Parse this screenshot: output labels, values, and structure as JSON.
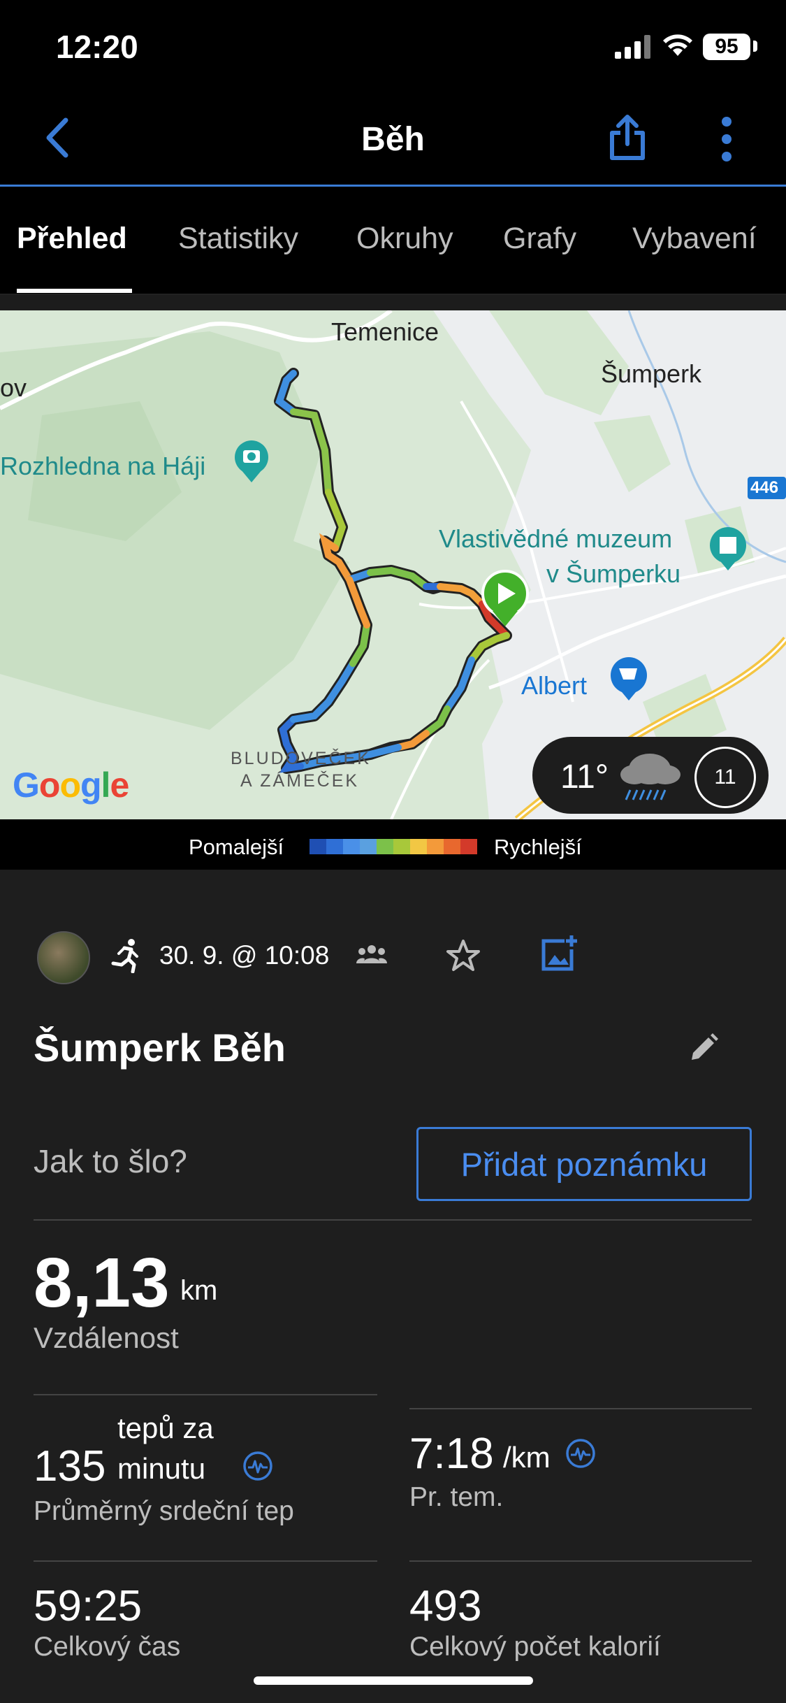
{
  "status_bar": {
    "time": "12:20",
    "battery": "95"
  },
  "nav": {
    "title": "Běh",
    "icons": [
      "back-chevron-icon",
      "share-icon",
      "more-vertical-icon"
    ]
  },
  "tabs": [
    {
      "label": "Přehled",
      "active": true
    },
    {
      "label": "Statistiky",
      "active": false
    },
    {
      "label": "Okruhy",
      "active": false
    },
    {
      "label": "Grafy",
      "active": false
    },
    {
      "label": "Vybavení",
      "active": false
    }
  ],
  "map": {
    "labels": {
      "temenice": "Temenice",
      "sumperk": "Šumperk",
      "rozhledna": "Rozhledna na Háji",
      "muzeum_line1": "Vlastivědné muzeum",
      "muzeum_line2": "v Šumperku",
      "albert": "Albert",
      "bludovecek_line1": "BLUDOVEČEK",
      "bludovecek_line2": "A ZÁMEČEK",
      "road_number": "446",
      "edge_text": "ov"
    },
    "attribution": "Google",
    "weather": {
      "temp": "11°",
      "icon": "rain-cloud-icon",
      "moon_day": "11"
    }
  },
  "legend": {
    "slower": "Pomalejší",
    "faster": "Rychlejší",
    "colors": [
      "#1f4fb3",
      "#2f6fd6",
      "#4a90e8",
      "#5aa0e0",
      "#7cc14a",
      "#a8c83a",
      "#f2c744",
      "#f39a3a",
      "#e8682e",
      "#d33a2a"
    ]
  },
  "activity": {
    "date": "30. 9. @ 10:08",
    "name": "Šumperk Běh",
    "how_prompt": "Jak to šlo?",
    "add_note": "Přidat poznámku"
  },
  "stats": {
    "distance": {
      "value": "8,13",
      "unit": "km",
      "label": "Vzdálenost"
    },
    "heart_rate": {
      "value": "135",
      "unit_line1": "tepů za",
      "unit_line2": "minutu",
      "label": "Průměrný srdeční tep"
    },
    "pace": {
      "value": "7:18",
      "unit": "/km",
      "label": "Pr. tem."
    },
    "time": {
      "value": "59:25",
      "label": "Celkový čas"
    },
    "calories": {
      "value": "493",
      "label": "Celkový počet kalorií"
    }
  },
  "colors": {
    "accent": "#3a7bd5",
    "background": "#1e1e1e"
  }
}
